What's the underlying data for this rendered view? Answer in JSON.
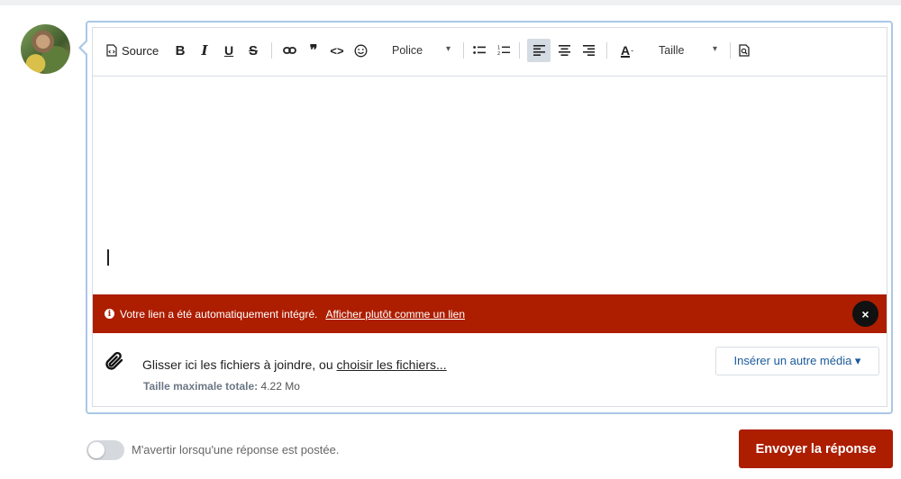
{
  "toolbar": {
    "source_label": "Source",
    "bold_label": "B",
    "italic_label": "I",
    "underline_label": "U",
    "strike_label": "S",
    "quote_label": "❞",
    "code_label": "<>",
    "font_label": "Police",
    "size_label": "Taille",
    "dropdown_caret": "▾",
    "font_color_label": "A",
    "icons": [
      "source-icon",
      "link-icon",
      "quote-icon",
      "code-icon",
      "smiley-icon",
      "bullet-list-icon",
      "numbered-list-icon",
      "align-left-icon",
      "align-center-icon",
      "align-right-icon",
      "font-color-icon",
      "preview-icon"
    ]
  },
  "alert": {
    "message": "Votre lien a été automatiquement intégré.",
    "link_text": "Afficher plutôt comme un lien",
    "info_glyph": "i",
    "close_glyph": "×",
    "color": "#ad1d00"
  },
  "attachments": {
    "prefix": "Glisser ici les fichiers à joindre, ou",
    "choose_link": "choisir les fichiers...",
    "limit_label": "Taille maximale totale:",
    "limit_value": "4.22 Mo",
    "insert_media_label": "Insérer un autre média ▾"
  },
  "footer": {
    "notify_label": "M'avertir lorsqu'une réponse est postée.",
    "submit_label": "Envoyer la réponse",
    "notify_on": false
  }
}
